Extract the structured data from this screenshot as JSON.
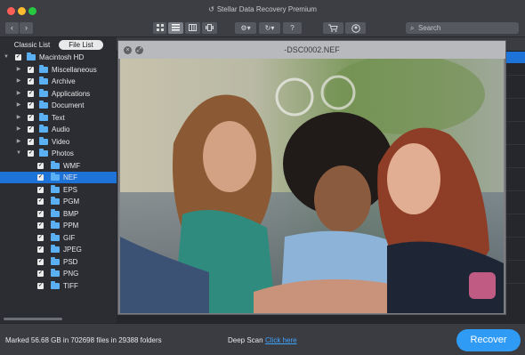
{
  "window": {
    "title": "Stellar Data Recovery Premium"
  },
  "toolbar": {
    "back": "‹",
    "forward": "›",
    "view_icons": [
      "grid-view-icon",
      "list-view-icon",
      "column-view-icon",
      "cover-flow-icon"
    ],
    "settings_icon": "gear-icon",
    "history_icon": "history-icon",
    "help_label": "?",
    "cart_icon": "cart-icon",
    "account_icon": "account-icon",
    "search_placeholder": "Search"
  },
  "tabs": {
    "classic": "Classic List",
    "file": "File List"
  },
  "tree": [
    {
      "label": "Macintosh HD",
      "level": 0,
      "expanded": true
    },
    {
      "label": "Miscellaneous",
      "level": 1,
      "expanded": false
    },
    {
      "label": "Archive",
      "level": 1,
      "expanded": false
    },
    {
      "label": "Applications",
      "level": 1,
      "expanded": false
    },
    {
      "label": "Document",
      "level": 1,
      "expanded": false
    },
    {
      "label": "Text",
      "level": 1,
      "expanded": false
    },
    {
      "label": "Audio",
      "level": 1,
      "expanded": false
    },
    {
      "label": "Video",
      "level": 1,
      "expanded": false
    },
    {
      "label": "Photos",
      "level": 1,
      "expanded": true
    },
    {
      "label": "WMF",
      "level": 2
    },
    {
      "label": "NEF",
      "level": 2,
      "selected": true
    },
    {
      "label": "EPS",
      "level": 2
    },
    {
      "label": "PGM",
      "level": 2
    },
    {
      "label": "BMP",
      "level": 2
    },
    {
      "label": "PPM",
      "level": 2
    },
    {
      "label": "GIF",
      "level": 2
    },
    {
      "label": "JPEG",
      "level": 2
    },
    {
      "label": "PSD",
      "level": 2
    },
    {
      "label": "PNG",
      "level": 2
    },
    {
      "label": "TIFF",
      "level": 2
    }
  ],
  "preview": {
    "title": "-DSC0002.NEF"
  },
  "status": {
    "marked": "Marked 56.68 GB in 702698 files in 29388 folders",
    "deep_scan": "Deep Scan",
    "click_here": "Click here",
    "recover": "Recover"
  },
  "colors": {
    "accent": "#1e73d8",
    "recover": "#2f9bf5",
    "folder": "#5ab0f2"
  }
}
